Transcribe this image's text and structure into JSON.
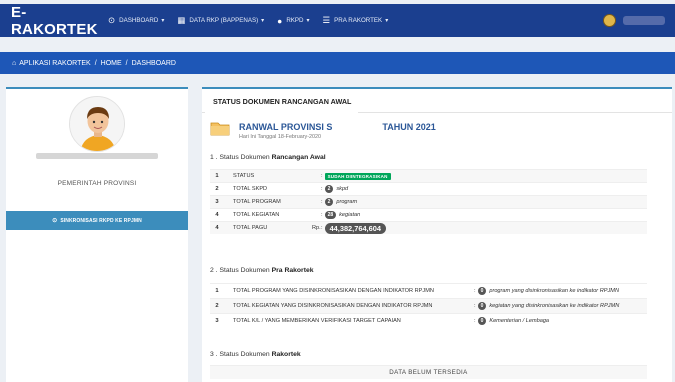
{
  "app": {
    "brand": "E-RAKORTEK"
  },
  "nav": {
    "items": [
      {
        "icon": "dashboard-icon",
        "glyph": "⊙",
        "label": "DASHBOARD"
      },
      {
        "icon": "table-icon",
        "glyph": "▦",
        "label": "DATA RKP (BAPPENAS)"
      },
      {
        "icon": "circle-icon",
        "glyph": "●",
        "label": "RKPD"
      },
      {
        "icon": "list-icon",
        "glyph": "☰",
        "label": "PRA RAKORTEK"
      }
    ],
    "caret": "▾"
  },
  "breadcrumb": {
    "items": [
      "APLIKASI RAKORTEK",
      "HOME",
      "DASHBOARD"
    ],
    "separator": "/"
  },
  "profile": {
    "org": "PEMERINTAH PROVINSI",
    "sync_label": "SINKRONISASI RKPD KE RPJMN"
  },
  "main": {
    "tab": "STATUS DOKUMEN RANCANGAN AWAL",
    "doc_title_left": "RANWAL PROVINSI S",
    "doc_title_right": "TAHUN 2021",
    "doc_date": "Hari Ini Tanggal 18-February-2020",
    "section1": {
      "prefix": "1 . Status Dokumen ",
      "bold": "Rancangan Awal"
    },
    "section2": {
      "prefix": "2 . Status Dokumen ",
      "bold": "Pra Rakortek"
    },
    "section3": {
      "prefix": "3 . Status Dokumen ",
      "bold": "Rakortek"
    },
    "table1": [
      {
        "no": "1",
        "label": "STATUS",
        "badge": "SUDAH DIINTEGRASIKAN"
      },
      {
        "no": "2",
        "label": "TOTAL SKPD",
        "count": "2",
        "unit": "skpd"
      },
      {
        "no": "3",
        "label": "TOTAL PROGRAM",
        "count": "2",
        "unit": "program"
      },
      {
        "no": "4",
        "label": "TOTAL KEGIATAN",
        "count": "28",
        "unit": "kegiatan"
      },
      {
        "no": "4",
        "label": "TOTAL PAGU",
        "currency": "Rp.",
        "count": "44,382,764,604"
      }
    ],
    "table2": [
      {
        "no": "1",
        "label": "TOTAL PROGRAM YANG DISINKRONISASIKAN DENGAN INDIKATOR RPJMN",
        "count": "0",
        "unit": "program yang disinkronisasikan ke indikator RPJMN"
      },
      {
        "no": "2",
        "label": "TOTAL KEGIATAN YANG DISINKRONISASIKAN DENGAN INDIKATOR RPJMN",
        "count": "0",
        "unit": "kegiatan yang disinkronisasikan ke indikator RPJMN"
      },
      {
        "no": "3",
        "label": "TOTAL K/L / YANG MEMBERIKAN VERIFIKASI TARGET CAPAIAN",
        "count": "0",
        "unit": "Kementerian / Lembaga"
      }
    ],
    "colon": ":",
    "no_data": "DATA BELUM TERSEDIA"
  },
  "colors": {
    "topbar": "#1b3f8f",
    "crumbbar": "#1e57b7",
    "accent": "#3c8dbc",
    "success": "#00a65a"
  }
}
